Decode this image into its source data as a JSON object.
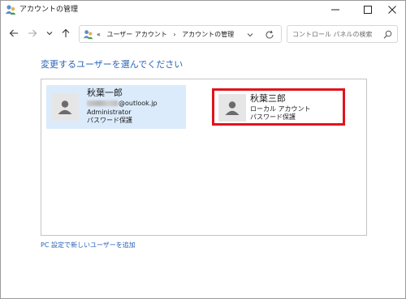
{
  "window": {
    "title": "アカウントの管理"
  },
  "titlebar": {
    "icons": [
      "user-accounts-icon",
      "minimize-icon",
      "maximize-icon",
      "close-icon"
    ]
  },
  "nav": {
    "icons": [
      "back-arrow-icon",
      "forward-arrow-icon",
      "recent-dropdown-icon",
      "up-arrow-icon"
    ],
    "address": {
      "overflow": "«",
      "crumbs": [
        "ユーザー アカウント",
        "›",
        "アカウントの管理"
      ]
    },
    "search_placeholder": "コントロール パネルの検索"
  },
  "main": {
    "heading": "変更するユーザーを選んでください",
    "accounts": [
      {
        "name": "秋葉一郎",
        "email_suffix": "@outlook.jp",
        "role": "Administrator",
        "protection": "パスワード保護",
        "selected": true
      },
      {
        "name": "秋葉三郎",
        "type": "ローカル アカウント",
        "protection": "パスワード保護",
        "highlighted": true
      }
    ],
    "add_user_link": "PC 設定で新しいユーザーを追加"
  },
  "colors": {
    "link": "#2a64b8",
    "selected_tile": "#dcebfb",
    "highlight_border": "#e0141c",
    "avatar_bg": "#e6e6e6"
  }
}
